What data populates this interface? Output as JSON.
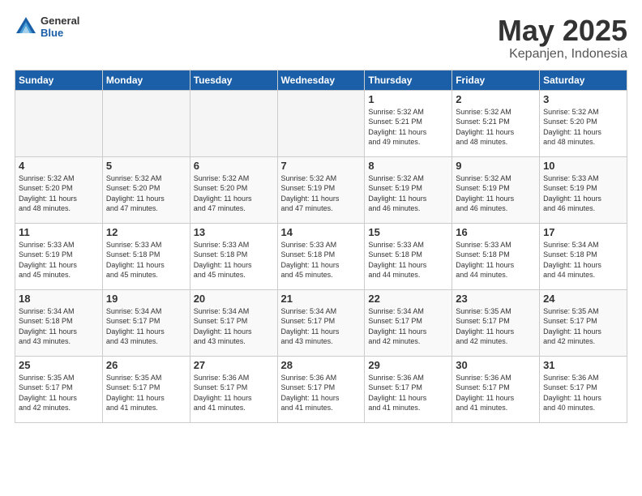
{
  "header": {
    "logo_general": "General",
    "logo_blue": "Blue",
    "main_title": "May 2025",
    "subtitle": "Kepanjen, Indonesia"
  },
  "days_of_week": [
    "Sunday",
    "Monday",
    "Tuesday",
    "Wednesday",
    "Thursday",
    "Friday",
    "Saturday"
  ],
  "weeks": [
    [
      {
        "day": "",
        "info": "",
        "empty": true
      },
      {
        "day": "",
        "info": "",
        "empty": true
      },
      {
        "day": "",
        "info": "",
        "empty": true
      },
      {
        "day": "",
        "info": "",
        "empty": true
      },
      {
        "day": "1",
        "info": "Sunrise: 5:32 AM\nSunset: 5:21 PM\nDaylight: 11 hours\nand 49 minutes."
      },
      {
        "day": "2",
        "info": "Sunrise: 5:32 AM\nSunset: 5:21 PM\nDaylight: 11 hours\nand 48 minutes."
      },
      {
        "day": "3",
        "info": "Sunrise: 5:32 AM\nSunset: 5:20 PM\nDaylight: 11 hours\nand 48 minutes."
      }
    ],
    [
      {
        "day": "4",
        "info": "Sunrise: 5:32 AM\nSunset: 5:20 PM\nDaylight: 11 hours\nand 48 minutes."
      },
      {
        "day": "5",
        "info": "Sunrise: 5:32 AM\nSunset: 5:20 PM\nDaylight: 11 hours\nand 47 minutes."
      },
      {
        "day": "6",
        "info": "Sunrise: 5:32 AM\nSunset: 5:20 PM\nDaylight: 11 hours\nand 47 minutes."
      },
      {
        "day": "7",
        "info": "Sunrise: 5:32 AM\nSunset: 5:19 PM\nDaylight: 11 hours\nand 47 minutes."
      },
      {
        "day": "8",
        "info": "Sunrise: 5:32 AM\nSunset: 5:19 PM\nDaylight: 11 hours\nand 46 minutes."
      },
      {
        "day": "9",
        "info": "Sunrise: 5:32 AM\nSunset: 5:19 PM\nDaylight: 11 hours\nand 46 minutes."
      },
      {
        "day": "10",
        "info": "Sunrise: 5:33 AM\nSunset: 5:19 PM\nDaylight: 11 hours\nand 46 minutes."
      }
    ],
    [
      {
        "day": "11",
        "info": "Sunrise: 5:33 AM\nSunset: 5:19 PM\nDaylight: 11 hours\nand 45 minutes."
      },
      {
        "day": "12",
        "info": "Sunrise: 5:33 AM\nSunset: 5:18 PM\nDaylight: 11 hours\nand 45 minutes."
      },
      {
        "day": "13",
        "info": "Sunrise: 5:33 AM\nSunset: 5:18 PM\nDaylight: 11 hours\nand 45 minutes."
      },
      {
        "day": "14",
        "info": "Sunrise: 5:33 AM\nSunset: 5:18 PM\nDaylight: 11 hours\nand 45 minutes."
      },
      {
        "day": "15",
        "info": "Sunrise: 5:33 AM\nSunset: 5:18 PM\nDaylight: 11 hours\nand 44 minutes."
      },
      {
        "day": "16",
        "info": "Sunrise: 5:33 AM\nSunset: 5:18 PM\nDaylight: 11 hours\nand 44 minutes."
      },
      {
        "day": "17",
        "info": "Sunrise: 5:34 AM\nSunset: 5:18 PM\nDaylight: 11 hours\nand 44 minutes."
      }
    ],
    [
      {
        "day": "18",
        "info": "Sunrise: 5:34 AM\nSunset: 5:18 PM\nDaylight: 11 hours\nand 43 minutes."
      },
      {
        "day": "19",
        "info": "Sunrise: 5:34 AM\nSunset: 5:17 PM\nDaylight: 11 hours\nand 43 minutes."
      },
      {
        "day": "20",
        "info": "Sunrise: 5:34 AM\nSunset: 5:17 PM\nDaylight: 11 hours\nand 43 minutes."
      },
      {
        "day": "21",
        "info": "Sunrise: 5:34 AM\nSunset: 5:17 PM\nDaylight: 11 hours\nand 43 minutes."
      },
      {
        "day": "22",
        "info": "Sunrise: 5:34 AM\nSunset: 5:17 PM\nDaylight: 11 hours\nand 42 minutes."
      },
      {
        "day": "23",
        "info": "Sunrise: 5:35 AM\nSunset: 5:17 PM\nDaylight: 11 hours\nand 42 minutes."
      },
      {
        "day": "24",
        "info": "Sunrise: 5:35 AM\nSunset: 5:17 PM\nDaylight: 11 hours\nand 42 minutes."
      }
    ],
    [
      {
        "day": "25",
        "info": "Sunrise: 5:35 AM\nSunset: 5:17 PM\nDaylight: 11 hours\nand 42 minutes."
      },
      {
        "day": "26",
        "info": "Sunrise: 5:35 AM\nSunset: 5:17 PM\nDaylight: 11 hours\nand 41 minutes."
      },
      {
        "day": "27",
        "info": "Sunrise: 5:36 AM\nSunset: 5:17 PM\nDaylight: 11 hours\nand 41 minutes."
      },
      {
        "day": "28",
        "info": "Sunrise: 5:36 AM\nSunset: 5:17 PM\nDaylight: 11 hours\nand 41 minutes."
      },
      {
        "day": "29",
        "info": "Sunrise: 5:36 AM\nSunset: 5:17 PM\nDaylight: 11 hours\nand 41 minutes."
      },
      {
        "day": "30",
        "info": "Sunrise: 5:36 AM\nSunset: 5:17 PM\nDaylight: 11 hours\nand 41 minutes."
      },
      {
        "day": "31",
        "info": "Sunrise: 5:36 AM\nSunset: 5:17 PM\nDaylight: 11 hours\nand 40 minutes."
      }
    ]
  ]
}
